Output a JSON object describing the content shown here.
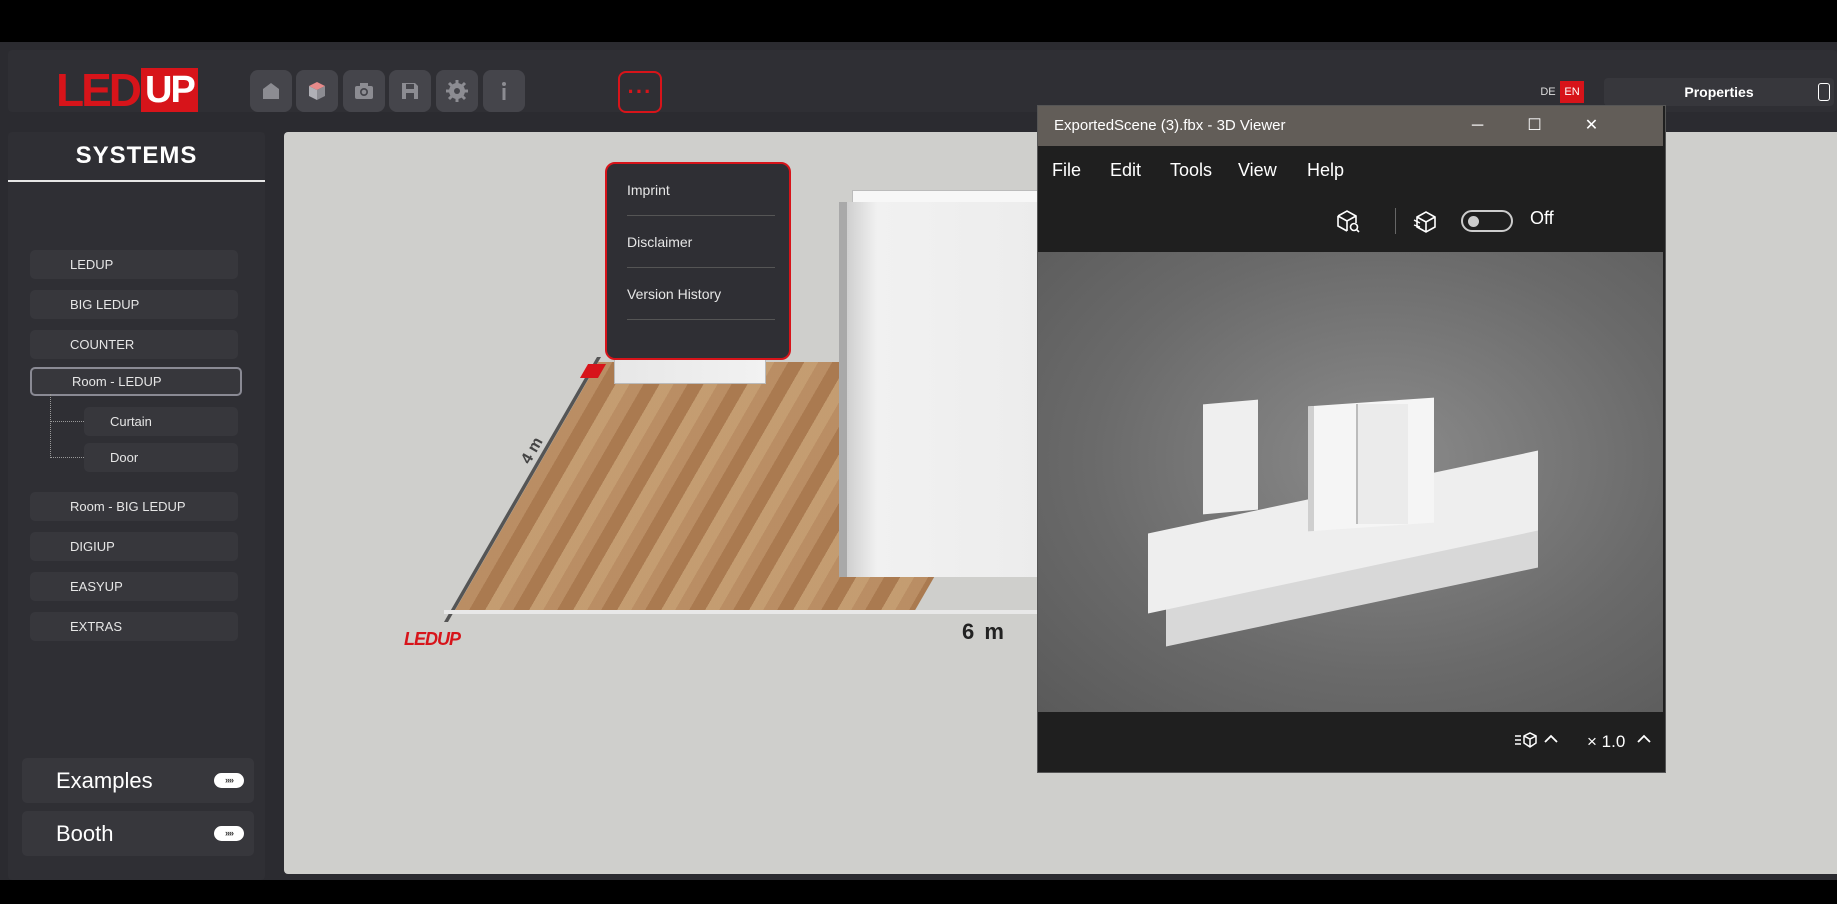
{
  "logo": {
    "led": "LED",
    "up": "UP"
  },
  "toolbar": {
    "buttons": [
      "home-icon",
      "cube-icon",
      "camera-icon",
      "save-icon",
      "settings-icon",
      "info-icon",
      "more-icon"
    ],
    "more_label": "···"
  },
  "lang": {
    "de": "DE",
    "en": "EN"
  },
  "properties": {
    "label": "Properties"
  },
  "sidebar": {
    "title": "SYSTEMS",
    "items": [
      "LEDUP",
      "BIG LEDUP",
      "COUNTER",
      "Room - LEDUP",
      "Curtain",
      "Door",
      "Room - BIG LEDUP",
      "DIGIUP",
      "EASYUP",
      "EXTRAS"
    ],
    "examples": "Examples",
    "booth": "Booth",
    "toggle_glyph": "»»"
  },
  "dropdown": {
    "items": [
      "Imprint",
      "Disclaimer",
      "Version History"
    ]
  },
  "viewport": {
    "measure_x": "6 m",
    "measure_y": "4 m",
    "floor_logo": "LEDUP"
  },
  "viewer": {
    "title": "ExportedScene (3).fbx - 3D Viewer",
    "controls": {
      "minimize": "─",
      "maximize": "☐",
      "close": "✕"
    },
    "menu": [
      "File",
      "Edit",
      "Tools",
      "View",
      "Help"
    ],
    "toggle_state": "Off",
    "zoom": "× 1.0"
  },
  "colors": {
    "accent": "#d7141a",
    "sidebar": "#2f2f34",
    "viewport": "#cfcfcc"
  }
}
